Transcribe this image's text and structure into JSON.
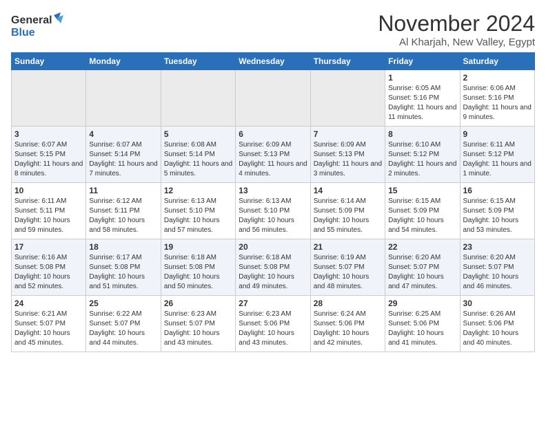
{
  "header": {
    "logo_line1": "General",
    "logo_line2": "Blue",
    "month_year": "November 2024",
    "location": "Al Kharjah, New Valley, Egypt"
  },
  "days_of_week": [
    "Sunday",
    "Monday",
    "Tuesday",
    "Wednesday",
    "Thursday",
    "Friday",
    "Saturday"
  ],
  "weeks": [
    [
      {
        "day": "",
        "info": ""
      },
      {
        "day": "",
        "info": ""
      },
      {
        "day": "",
        "info": ""
      },
      {
        "day": "",
        "info": ""
      },
      {
        "day": "",
        "info": ""
      },
      {
        "day": "1",
        "info": "Sunrise: 6:05 AM\nSunset: 5:16 PM\nDaylight: 11 hours and 11 minutes."
      },
      {
        "day": "2",
        "info": "Sunrise: 6:06 AM\nSunset: 5:16 PM\nDaylight: 11 hours and 9 minutes."
      }
    ],
    [
      {
        "day": "3",
        "info": "Sunrise: 6:07 AM\nSunset: 5:15 PM\nDaylight: 11 hours and 8 minutes."
      },
      {
        "day": "4",
        "info": "Sunrise: 6:07 AM\nSunset: 5:14 PM\nDaylight: 11 hours and 7 minutes."
      },
      {
        "day": "5",
        "info": "Sunrise: 6:08 AM\nSunset: 5:14 PM\nDaylight: 11 hours and 5 minutes."
      },
      {
        "day": "6",
        "info": "Sunrise: 6:09 AM\nSunset: 5:13 PM\nDaylight: 11 hours and 4 minutes."
      },
      {
        "day": "7",
        "info": "Sunrise: 6:09 AM\nSunset: 5:13 PM\nDaylight: 11 hours and 3 minutes."
      },
      {
        "day": "8",
        "info": "Sunrise: 6:10 AM\nSunset: 5:12 PM\nDaylight: 11 hours and 2 minutes."
      },
      {
        "day": "9",
        "info": "Sunrise: 6:11 AM\nSunset: 5:12 PM\nDaylight: 11 hours and 1 minute."
      }
    ],
    [
      {
        "day": "10",
        "info": "Sunrise: 6:11 AM\nSunset: 5:11 PM\nDaylight: 10 hours and 59 minutes."
      },
      {
        "day": "11",
        "info": "Sunrise: 6:12 AM\nSunset: 5:11 PM\nDaylight: 10 hours and 58 minutes."
      },
      {
        "day": "12",
        "info": "Sunrise: 6:13 AM\nSunset: 5:10 PM\nDaylight: 10 hours and 57 minutes."
      },
      {
        "day": "13",
        "info": "Sunrise: 6:13 AM\nSunset: 5:10 PM\nDaylight: 10 hours and 56 minutes."
      },
      {
        "day": "14",
        "info": "Sunrise: 6:14 AM\nSunset: 5:09 PM\nDaylight: 10 hours and 55 minutes."
      },
      {
        "day": "15",
        "info": "Sunrise: 6:15 AM\nSunset: 5:09 PM\nDaylight: 10 hours and 54 minutes."
      },
      {
        "day": "16",
        "info": "Sunrise: 6:15 AM\nSunset: 5:09 PM\nDaylight: 10 hours and 53 minutes."
      }
    ],
    [
      {
        "day": "17",
        "info": "Sunrise: 6:16 AM\nSunset: 5:08 PM\nDaylight: 10 hours and 52 minutes."
      },
      {
        "day": "18",
        "info": "Sunrise: 6:17 AM\nSunset: 5:08 PM\nDaylight: 10 hours and 51 minutes."
      },
      {
        "day": "19",
        "info": "Sunrise: 6:18 AM\nSunset: 5:08 PM\nDaylight: 10 hours and 50 minutes."
      },
      {
        "day": "20",
        "info": "Sunrise: 6:18 AM\nSunset: 5:08 PM\nDaylight: 10 hours and 49 minutes."
      },
      {
        "day": "21",
        "info": "Sunrise: 6:19 AM\nSunset: 5:07 PM\nDaylight: 10 hours and 48 minutes."
      },
      {
        "day": "22",
        "info": "Sunrise: 6:20 AM\nSunset: 5:07 PM\nDaylight: 10 hours and 47 minutes."
      },
      {
        "day": "23",
        "info": "Sunrise: 6:20 AM\nSunset: 5:07 PM\nDaylight: 10 hours and 46 minutes."
      }
    ],
    [
      {
        "day": "24",
        "info": "Sunrise: 6:21 AM\nSunset: 5:07 PM\nDaylight: 10 hours and 45 minutes."
      },
      {
        "day": "25",
        "info": "Sunrise: 6:22 AM\nSunset: 5:07 PM\nDaylight: 10 hours and 44 minutes."
      },
      {
        "day": "26",
        "info": "Sunrise: 6:23 AM\nSunset: 5:07 PM\nDaylight: 10 hours and 43 minutes."
      },
      {
        "day": "27",
        "info": "Sunrise: 6:23 AM\nSunset: 5:06 PM\nDaylight: 10 hours and 43 minutes."
      },
      {
        "day": "28",
        "info": "Sunrise: 6:24 AM\nSunset: 5:06 PM\nDaylight: 10 hours and 42 minutes."
      },
      {
        "day": "29",
        "info": "Sunrise: 6:25 AM\nSunset: 5:06 PM\nDaylight: 10 hours and 41 minutes."
      },
      {
        "day": "30",
        "info": "Sunrise: 6:26 AM\nSunset: 5:06 PM\nDaylight: 10 hours and 40 minutes."
      }
    ]
  ]
}
